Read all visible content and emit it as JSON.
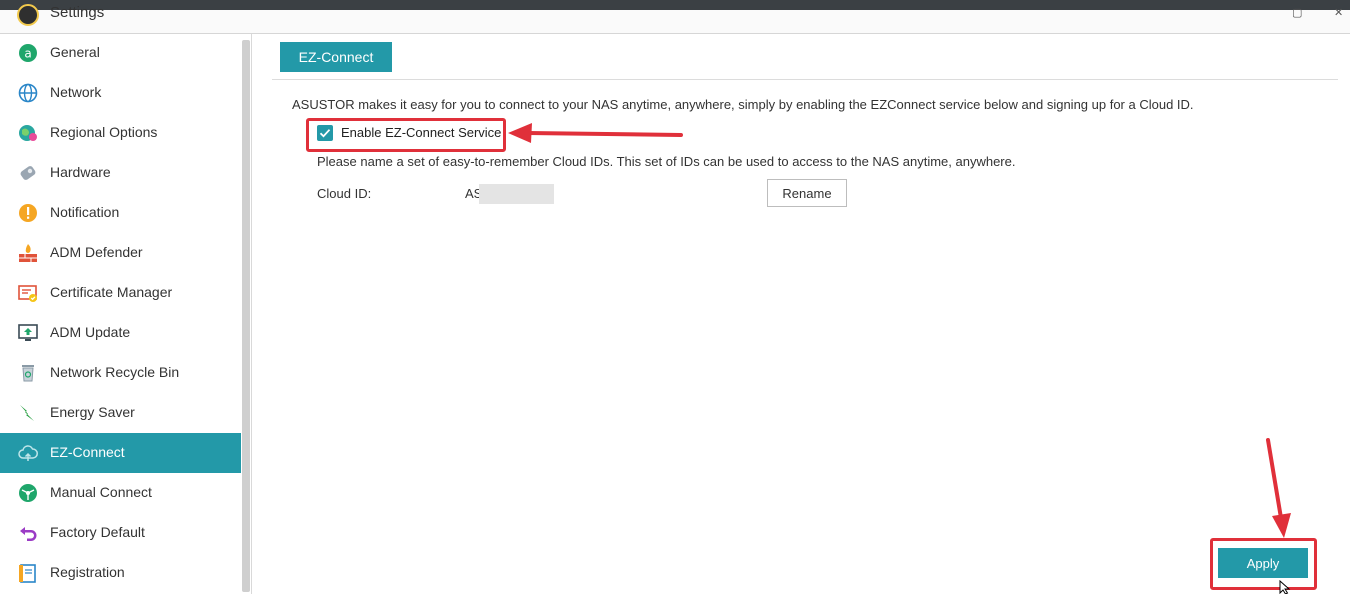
{
  "window": {
    "title": "Settings"
  },
  "sidebar": {
    "items": [
      {
        "label": "General",
        "icon": "general-icon"
      },
      {
        "label": "Network",
        "icon": "globe-icon"
      },
      {
        "label": "Regional Options",
        "icon": "regional-icon"
      },
      {
        "label": "Hardware",
        "icon": "hardware-icon"
      },
      {
        "label": "Notification",
        "icon": "notification-icon"
      },
      {
        "label": "ADM Defender",
        "icon": "firewall-icon"
      },
      {
        "label": "Certificate Manager",
        "icon": "certificate-icon"
      },
      {
        "label": "ADM Update",
        "icon": "update-icon"
      },
      {
        "label": "Network Recycle Bin",
        "icon": "recycle-bin-icon"
      },
      {
        "label": "Energy Saver",
        "icon": "energy-icon"
      },
      {
        "label": "EZ-Connect",
        "icon": "cloud-icon",
        "active": true
      },
      {
        "label": "Manual Connect",
        "icon": "manual-connect-icon"
      },
      {
        "label": "Factory Default",
        "icon": "undo-icon"
      },
      {
        "label": "Registration",
        "icon": "registration-icon"
      }
    ]
  },
  "main": {
    "tab_label": "EZ-Connect",
    "intro": "ASUSTOR makes it easy for you to connect to your NAS anytime, anywhere, simply by enabling the EZConnect service below and signing up for a Cloud ID.",
    "enable_label": "Enable EZ-Connect Service",
    "enable_checked": true,
    "description": "Please name a set of easy-to-remember Cloud IDs. This set of IDs can be used to access to the NAS anytime, anywhere.",
    "cloud_id_label": "Cloud ID:",
    "cloud_id_value": "AS",
    "rename_label": "Rename",
    "apply_label": "Apply"
  },
  "colors": {
    "accent": "#2399a8",
    "annotation": "#e0303a"
  }
}
